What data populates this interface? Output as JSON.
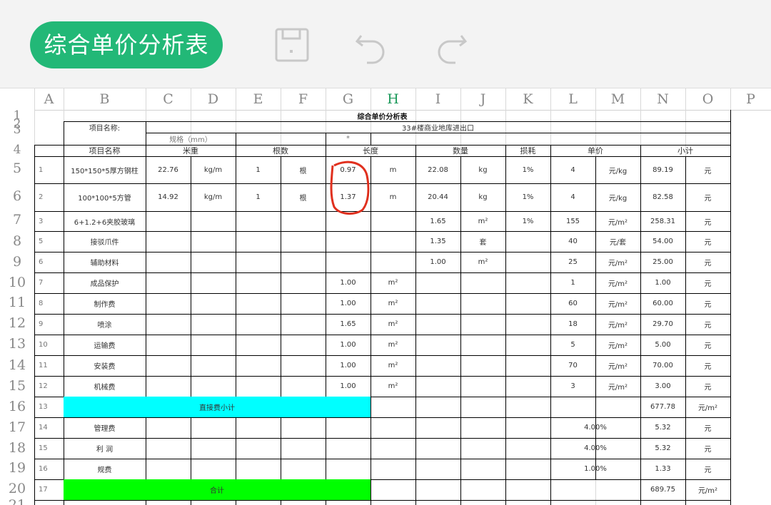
{
  "toolbar": {
    "title": "综合单价分析表",
    "icons": [
      "save-icon",
      "undo-icon",
      "redo-icon"
    ],
    "accent": "#22b877"
  },
  "columns": [
    "A",
    "B",
    "C",
    "D",
    "E",
    "F",
    "G",
    "H",
    "I",
    "J",
    "K",
    "L",
    "M",
    "N",
    "O",
    "P"
  ],
  "active_column": "H",
  "row_numbers": [
    "1",
    "2",
    "3",
    "4",
    "5",
    "6",
    "7",
    "8",
    "9",
    "10",
    "11",
    "12",
    "13",
    "14",
    "15",
    "16",
    "17",
    "18",
    "19",
    "20",
    "21"
  ],
  "sheet": {
    "title": "综合单价分析表",
    "project_label": "项目名称:",
    "project_value": "33#楼商业地库进出口",
    "spec_label": "规格（mm）",
    "spec_mark": "*",
    "headers": {
      "name": "项目名称",
      "weight": "米重",
      "count": "根数",
      "length": "长度",
      "quantity": "数量",
      "loss": "损耗",
      "unit_price": "单价",
      "subtotal": "小计"
    },
    "rows": [
      {
        "seq": "1",
        "name": "150*150*5厚方钢柱",
        "weight": "22.76",
        "weight_unit": "kg/m",
        "count": "1",
        "count_unit": "根",
        "length": "0.97",
        "length_unit": "m",
        "qty": "22.08",
        "qty_unit": "kg",
        "loss": "1%",
        "price": "4",
        "price_unit": "元/kg",
        "sub": "89.19",
        "sub_unit": "元"
      },
      {
        "seq": "2",
        "name": "100*100*5方管",
        "weight": "14.92",
        "weight_unit": "kg/m",
        "count": "1",
        "count_unit": "根",
        "length": "1.37",
        "length_unit": "m",
        "qty": "20.44",
        "qty_unit": "kg",
        "loss": "1%",
        "price": "4",
        "price_unit": "元/kg",
        "sub": "82.58",
        "sub_unit": "元"
      },
      {
        "seq": "3",
        "name": "6+1.2+6夹胶玻璃",
        "weight": "",
        "weight_unit": "",
        "count": "",
        "count_unit": "",
        "length": "",
        "length_unit": "",
        "qty": "1.65",
        "qty_unit": "m²",
        "loss": "1%",
        "price": "155",
        "price_unit": "元/m²",
        "sub": "258.31",
        "sub_unit": "元"
      },
      {
        "seq": "5",
        "name": "接驳爪件",
        "weight": "",
        "weight_unit": "",
        "count": "",
        "count_unit": "",
        "length": "",
        "length_unit": "",
        "qty": "1.35",
        "qty_unit": "套",
        "loss": "",
        "price": "40",
        "price_unit": "元/套",
        "sub": "54.00",
        "sub_unit": "元"
      },
      {
        "seq": "6",
        "name": "辅助材料",
        "weight": "",
        "weight_unit": "",
        "count": "",
        "count_unit": "",
        "length": "",
        "length_unit": "",
        "qty": "1.00",
        "qty_unit": "m²",
        "loss": "",
        "price": "25",
        "price_unit": "元/m²",
        "sub": "25.00",
        "sub_unit": "元"
      },
      {
        "seq": "7",
        "name": "成品保护",
        "weight": "",
        "weight_unit": "",
        "count": "",
        "count_unit": "",
        "length": "1.00",
        "length_unit": "m²",
        "qty": "",
        "qty_unit": "",
        "loss": "",
        "price": "1",
        "price_unit": "元/m²",
        "sub": "1.00",
        "sub_unit": "元"
      },
      {
        "seq": "8",
        "name": "制作费",
        "weight": "",
        "weight_unit": "",
        "count": "",
        "count_unit": "",
        "length": "1.00",
        "length_unit": "m²",
        "qty": "",
        "qty_unit": "",
        "loss": "",
        "price": "60",
        "price_unit": "元/m²",
        "sub": "60.00",
        "sub_unit": "元"
      },
      {
        "seq": "9",
        "name": "喷涂",
        "weight": "",
        "weight_unit": "",
        "count": "",
        "count_unit": "",
        "length": "1.65",
        "length_unit": "m²",
        "qty": "",
        "qty_unit": "",
        "loss": "",
        "price": "18",
        "price_unit": "元/m²",
        "sub": "29.70",
        "sub_unit": "元"
      },
      {
        "seq": "10",
        "name": "运输费",
        "weight": "",
        "weight_unit": "",
        "count": "",
        "count_unit": "",
        "length": "1.00",
        "length_unit": "m²",
        "qty": "",
        "qty_unit": "",
        "loss": "",
        "price": "5",
        "price_unit": "元/m²",
        "sub": "5.00",
        "sub_unit": "元"
      },
      {
        "seq": "11",
        "name": "安装费",
        "weight": "",
        "weight_unit": "",
        "count": "",
        "count_unit": "",
        "length": "1.00",
        "length_unit": "m²",
        "qty": "",
        "qty_unit": "",
        "loss": "",
        "price": "70",
        "price_unit": "元/m²",
        "sub": "70.00",
        "sub_unit": "元"
      },
      {
        "seq": "12",
        "name": "机械费",
        "weight": "",
        "weight_unit": "",
        "count": "",
        "count_unit": "",
        "length": "1.00",
        "length_unit": "m²",
        "qty": "",
        "qty_unit": "",
        "loss": "",
        "price": "3",
        "price_unit": "元/m²",
        "sub": "3.00",
        "sub_unit": "元"
      }
    ],
    "direct_cost": {
      "seq": "13",
      "label": "直接费小计",
      "sub": "677.78",
      "sub_unit": "元/m²",
      "color": "#00ffff"
    },
    "fees": [
      {
        "seq": "14",
        "name": "管理费",
        "rate": "4.00%",
        "sub": "5.32",
        "sub_unit": "元"
      },
      {
        "seq": "15",
        "name": "利  润",
        "rate": "4.00%",
        "sub": "5.32",
        "sub_unit": "元"
      },
      {
        "seq": "16",
        "name": "规费",
        "rate": "1.00%",
        "sub": "1.33",
        "sub_unit": "元"
      }
    ],
    "total": {
      "seq": "17",
      "label": "合计",
      "sub": "689.75",
      "sub_unit": "元/m²",
      "color": "#00ff00"
    },
    "annotation_color": "#e0301e"
  }
}
